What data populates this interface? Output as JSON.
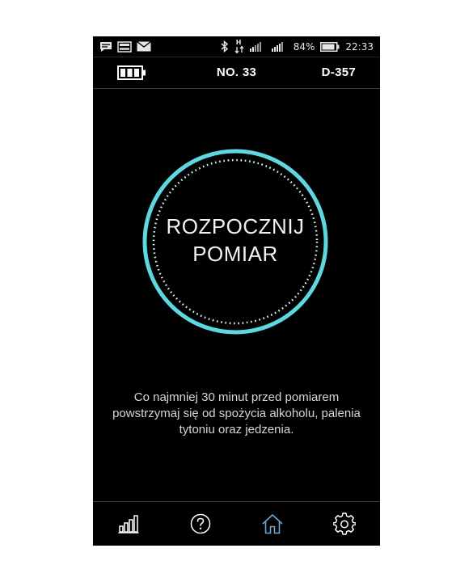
{
  "status_bar": {
    "icons_left": [
      "message-icon",
      "image-notification-icon",
      "mail-icon"
    ],
    "icons_right": [
      "bluetooth-icon",
      "data-transfer-icon",
      "signal-icon-1",
      "signal-icon-2"
    ],
    "data_indicator": "H",
    "battery_percent": "84%",
    "time": "22:33"
  },
  "header": {
    "battery_icon": "battery-full-icon",
    "number": "NO. 33",
    "device": "D-357"
  },
  "start_button": {
    "line1": "ROZPOCZNIJ",
    "line2": "POMIAR"
  },
  "notice": {
    "text": "Co najmniej 30 minut przed pomiarem powstrzymaj się od spożycia alkoholu, palenia tytoniu oraz jedzenia."
  },
  "bottom_nav": [
    {
      "icon": "bar-chart-icon",
      "active": false
    },
    {
      "icon": "help-icon",
      "active": false
    },
    {
      "icon": "home-icon",
      "active": true
    },
    {
      "icon": "settings-icon",
      "active": false
    }
  ],
  "colors": {
    "background": "#000000",
    "accent_ring": "#5fd7e0",
    "active_nav": "#6aa8d8",
    "text": "#ffffff"
  }
}
